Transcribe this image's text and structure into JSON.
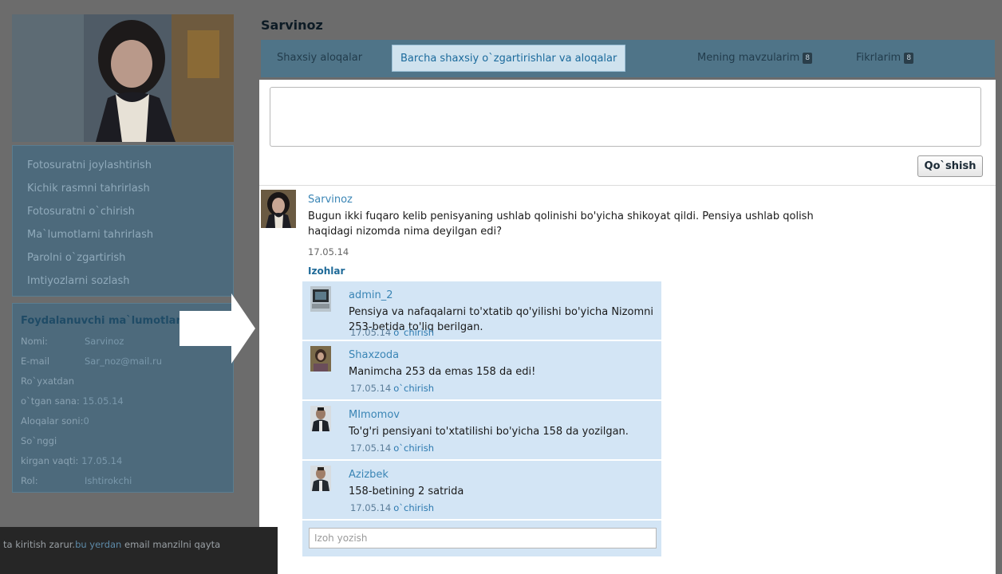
{
  "profile": {
    "name": "Sarvinoz",
    "menu": [
      "Fotosuratni joylashtirish",
      "Kichik rasmni tahrirlash",
      "Fotosuratni o`chirish",
      "Ma`lumotlarni tahrirlash",
      "Parolni o`zgartirish",
      "Imtiyozlarni sozlash"
    ],
    "info_title": "Foydalanuvchi ma`lumotlari",
    "info": {
      "name_label": "Nomi:",
      "name_value": "Sarvinoz",
      "email_label": "E-mail",
      "email_value": "Sar_noz@mail.ru",
      "reg_label_1": "Ro`yxatdan",
      "reg_label_2": "o`tgan sana:",
      "reg_value": "15.05.14",
      "contacts_label": "Aloqalar soni:",
      "contacts_value": "0",
      "last_label_1": "So`nggi",
      "last_label_2": "kirgan vaqti:",
      "last_value": "17.05.14",
      "role_label": "Rol:",
      "role_value": "Ishtirokchi"
    }
  },
  "tabs": [
    {
      "label": "Shaxsiy aloqalar",
      "badge": ""
    },
    {
      "label": "Barcha shaxsiy o`zgartirishlar va aloqalar",
      "badge": "",
      "active": true
    },
    {
      "label": "Mening mavzularim",
      "badge": "8"
    },
    {
      "label": "Fikrlarim",
      "badge": "8"
    }
  ],
  "composer": {
    "submit_label": "Qo`shish"
  },
  "post": {
    "author": "Sarvinoz",
    "text": "Bugun ikki fuqaro kelib penisyaning ushlab qolinishi bo'yicha shikoyat qildi. Pensiya ushlab qolish haqidagi nizomda nima deyilgan edi?",
    "date": "17.05.14",
    "comments_label": "Izohlar",
    "comments": [
      {
        "author": "admin_2",
        "text": "Pensiya va nafaqalarni to'xtatib qo'yilishi bo'yicha Nizomni 253-betida to'liq berilgan.",
        "date": "17.05.14",
        "delete_label": "o`chirish"
      },
      {
        "author": "Shaxzoda",
        "text": "Manimcha 253 da emas 158 da edi!",
        "date": "17.05.14",
        "delete_label": "o`chirish"
      },
      {
        "author": "MImomov",
        "text": "To'g'ri pensiyani to'xtatilishi bo'yicha 158 da yozilgan.",
        "date": "17.05.14",
        "delete_label": "o`chirish"
      },
      {
        "author": "Azizbek",
        "text": "158-betining 2 satrida",
        "date": "17.05.14",
        "delete_label": "o`chirish"
      }
    ],
    "reply_placeholder": "Izoh yozish"
  },
  "notice": {
    "text_before": "ta kiritish zarur.",
    "link": "bu yerdan",
    "text_after": " email manzilni qayta"
  }
}
